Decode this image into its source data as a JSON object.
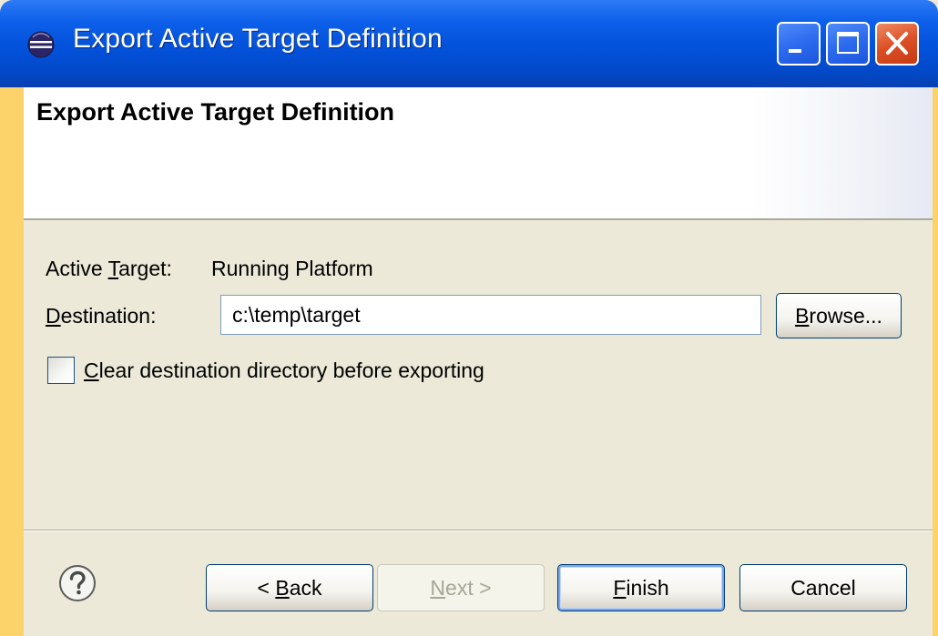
{
  "window": {
    "title": "Export Active Target Definition",
    "controls": [
      "minimize",
      "maximize",
      "close"
    ]
  },
  "banner": {
    "title": "Export Active Target Definition"
  },
  "form": {
    "active_target_label_pre": "Active ",
    "active_target_label_mn": "T",
    "active_target_label_post": "arget:",
    "active_target_value": "Running Platform",
    "destination_label_mn": "D",
    "destination_label_post": "estination:",
    "destination_value": "c:\\temp\\target",
    "browse_mn": "B",
    "browse_post": "rowse...",
    "clear_checkbox_mn": "C",
    "clear_checkbox_post": "lear destination directory before exporting",
    "clear_checked": false
  },
  "buttons": {
    "back_pre": "< ",
    "back_mn": "B",
    "back_post": "ack",
    "next_pre": "",
    "next_mn": "N",
    "next_post": "ext >",
    "finish_mn": "F",
    "finish_post": "inish",
    "cancel": "Cancel"
  },
  "colors": {
    "titlebar": "#0351DB",
    "dialog_bg": "#ECE9D8",
    "outer_bg": "#FCD36A",
    "close_button": "#DC4F26"
  },
  "icons": {
    "window_icon": "eclipse-icon",
    "help": "help-icon"
  }
}
